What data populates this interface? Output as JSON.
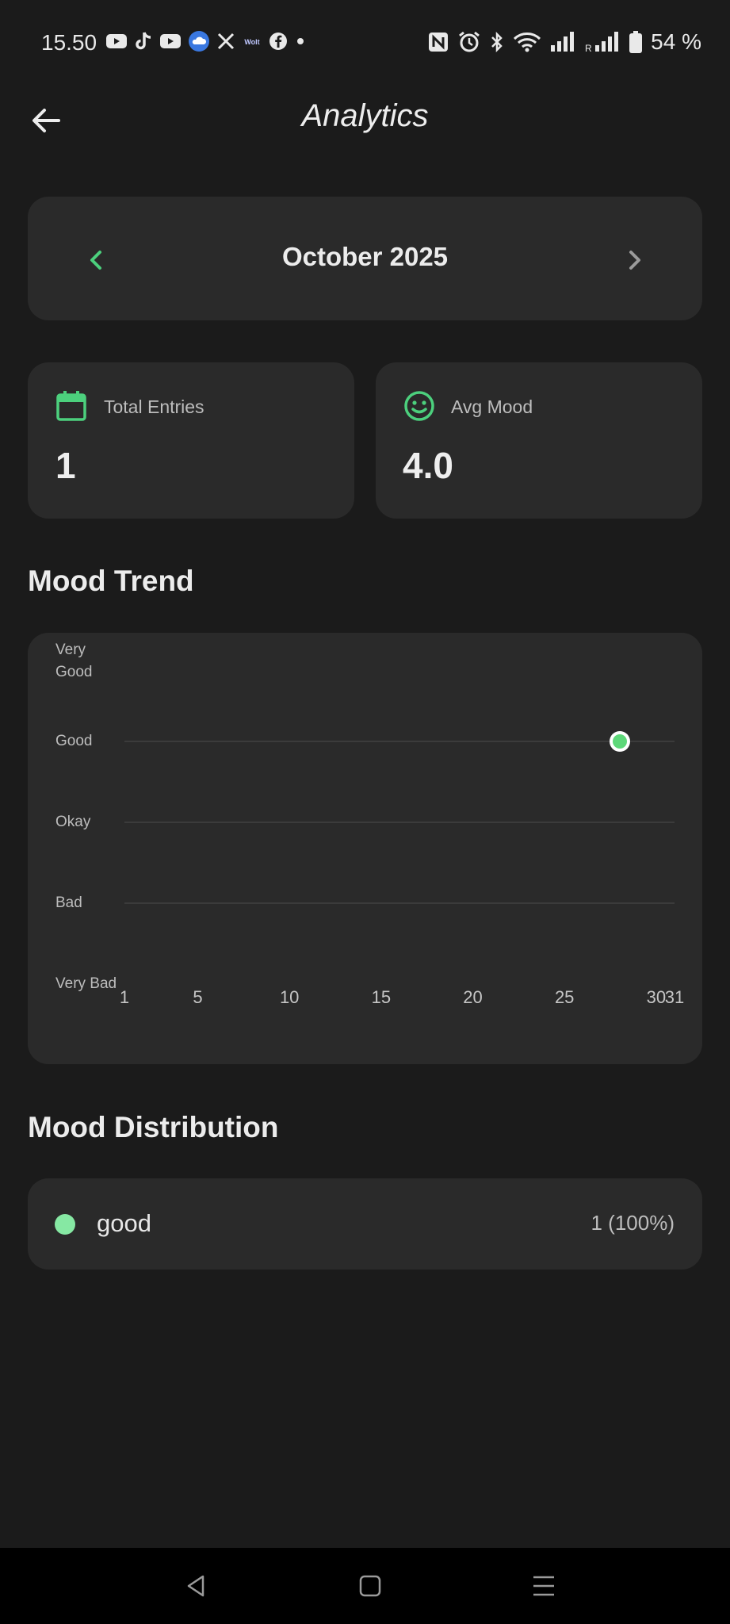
{
  "status_bar": {
    "time": "15.50",
    "battery_text": "54 %",
    "left_icons": [
      "youtube-icon",
      "tiktok-icon",
      "youtube-icon",
      "weather-icon",
      "x-icon",
      "wolt-icon",
      "facebook-icon",
      "dot-icon"
    ],
    "right_icons": [
      "nfc-icon",
      "alarm-icon",
      "bluetooth-icon",
      "wifi-icon",
      "signal-icon",
      "roaming-signal-icon",
      "battery-icon"
    ],
    "roaming_label": "R",
    "wolt_label": "Wolt"
  },
  "header": {
    "title": "Analytics",
    "back_icon": "arrow-left-icon"
  },
  "month_selector": {
    "label": "October 2025",
    "prev_icon": "chevron-left-icon",
    "next_icon": "chevron-right-icon"
  },
  "stats": {
    "total_entries": {
      "label": "Total Entries",
      "value": "1",
      "icon": "calendar-icon"
    },
    "avg_mood": {
      "label": "Avg Mood",
      "value": "4.0",
      "icon": "smiley-icon"
    }
  },
  "mood_trend": {
    "title": "Mood Trend"
  },
  "chart_data": {
    "type": "scatter",
    "ylabels": [
      "Very Good",
      "Good",
      "Okay",
      "Bad",
      "Very Bad"
    ],
    "yvalues": [
      5,
      4,
      3,
      2,
      1
    ],
    "xticks": [
      "1",
      "5",
      "10",
      "15",
      "20",
      "25",
      "30",
      "31"
    ],
    "xlim": [
      1,
      31
    ],
    "ylim": [
      1,
      5
    ],
    "series": [
      {
        "x": [
          28
        ],
        "y": [
          4
        ]
      }
    ],
    "point_color": "#5dd879",
    "grid": true
  },
  "mood_distribution": {
    "title": "Mood Distribution",
    "items": [
      {
        "label": "good",
        "value": "1 (100%)",
        "color": "#86e8a3"
      }
    ]
  },
  "colors": {
    "accent": "#4cd07d",
    "background": "#1b1b1b",
    "card": "#2a2a2a"
  },
  "nav_bar": {
    "icons": [
      "back-triangle-icon",
      "home-square-icon",
      "recents-menu-icon"
    ]
  }
}
